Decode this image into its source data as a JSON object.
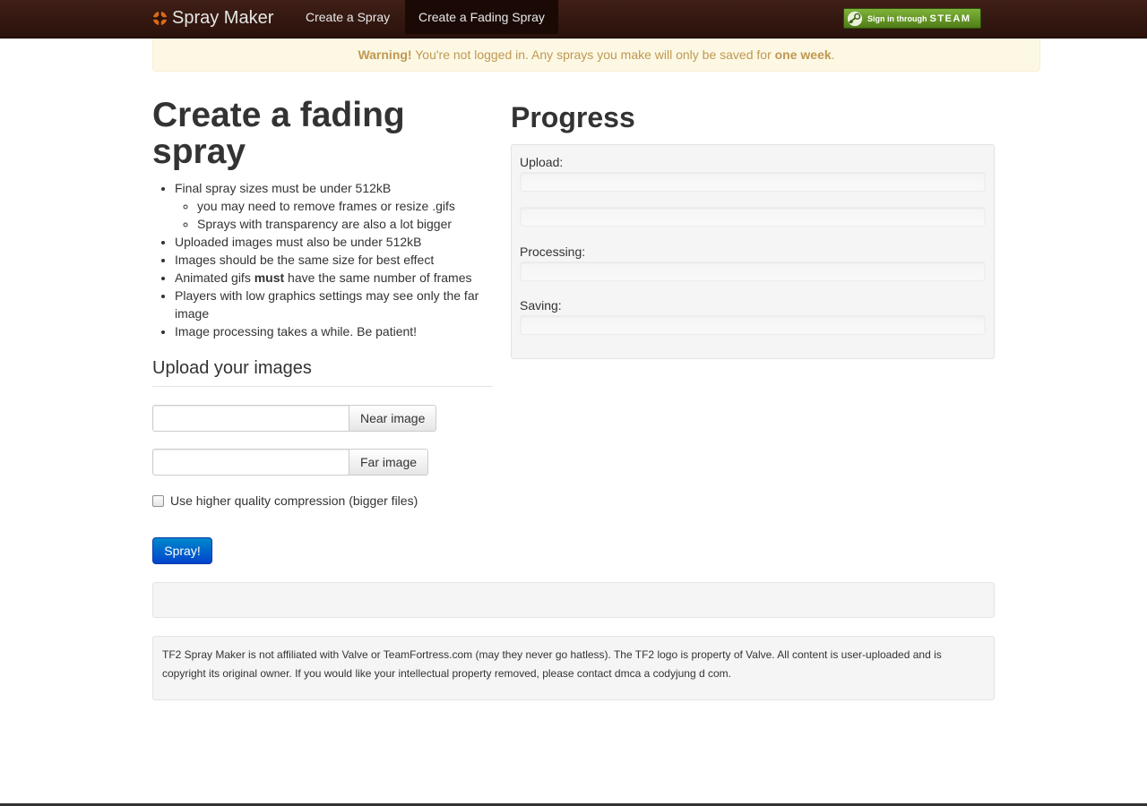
{
  "nav": {
    "brand": "Spray Maker",
    "items": [
      {
        "label": "Create a Spray"
      },
      {
        "label": "Create a Fading Spray",
        "active": true
      }
    ],
    "steam": {
      "prefix": "Sign in through",
      "word": "STEAM"
    }
  },
  "alert": {
    "strong": "Warning!",
    "text_before": " You're not logged in. Any sprays you make will only be saved for ",
    "emphasis": "one week",
    "text_after": "."
  },
  "main": {
    "title": "Create a fading spray",
    "rules": {
      "r1": "Final spray sizes must be under 512kB",
      "r1_sub": [
        "you may need to remove frames or resize .gifs",
        "Sprays with transparency are also a lot bigger"
      ],
      "r2": "Uploaded images must also be under 512kB",
      "r3": "Images should be the same size for best effect",
      "r4_before": "Animated gifs ",
      "r4_bold": "must",
      "r4_after": " have the same number of frames",
      "r5": "Players with low graphics settings may see only the far image",
      "r6": "Image processing takes a while. Be patient!"
    },
    "upload_heading": "Upload your images",
    "near_button": "Near image",
    "far_button": "Far image",
    "compression_label": "Use higher quality compression (bigger files)",
    "compression_checked": false,
    "spray_button": "Spray!"
  },
  "progress": {
    "title": "Progress",
    "labels": {
      "upload": "Upload:",
      "processing": "Processing:",
      "saving": "Saving:"
    },
    "values": {
      "upload_1": 0,
      "upload_2": 0,
      "processing": 0,
      "saving": 0
    }
  },
  "footer": {
    "text": "TF2 Spray Maker is not affiliated with Valve or TeamFortress.com (may they never go hatless). The TF2 logo is property of Valve. All content is user-uploaded and is copyright its original owner. If you would like your intellectual property removed, please contact dmca a codyjung d com."
  },
  "colors": {
    "navbar": "#2a120c",
    "alert_text": "#c09853",
    "alert_bg": "#fcf8e3",
    "primary_button": "#0055cc",
    "steam_green": "#5f9323"
  }
}
